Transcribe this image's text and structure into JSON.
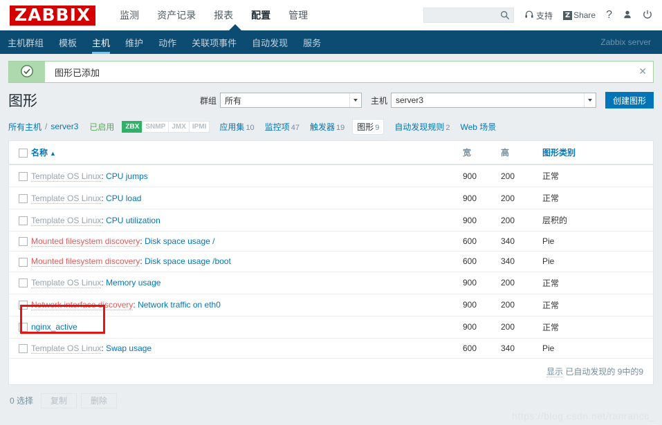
{
  "header": {
    "logo": "ZABBIX",
    "menu": [
      {
        "label": "监测",
        "selected": false
      },
      {
        "label": "资产记录",
        "selected": false
      },
      {
        "label": "报表",
        "selected": false
      },
      {
        "label": "配置",
        "selected": true
      },
      {
        "label": "管理",
        "selected": false
      }
    ],
    "search_placeholder": "",
    "search_value": "",
    "search_icon": "search-icon",
    "support_label": "支持",
    "support_icon": "headset-icon",
    "share_label": "Share",
    "share_icon": "zabbix-share-icon",
    "help_icon": "question-mark-icon",
    "user_icon": "user-icon",
    "signout_icon": "power-icon"
  },
  "subnav": {
    "items": [
      {
        "label": "主机群组",
        "selected": false
      },
      {
        "label": "模板",
        "selected": false
      },
      {
        "label": "主机",
        "selected": true
      },
      {
        "label": "维护",
        "selected": false
      },
      {
        "label": "动作",
        "selected": false
      },
      {
        "label": "关联项事件",
        "selected": false
      },
      {
        "label": "自动发现",
        "selected": false
      },
      {
        "label": "服务",
        "selected": false
      }
    ],
    "server": "Zabbix server"
  },
  "message": {
    "text": "图形已添加",
    "icon": "check-circle-icon",
    "close_icon": "close-icon",
    "accent": "#aed8ae"
  },
  "page": {
    "title": "图形",
    "group_label": "群组",
    "group_value": "所有",
    "host_label": "主机",
    "host_value": "server3",
    "create_button": "创建图形",
    "create_button_color": "#0275b8"
  },
  "breadcrumb": {
    "all_hosts": "所有主机",
    "separator": "/",
    "host": "server3",
    "status": "已启用",
    "status_color": "#5aab5a",
    "badges": [
      {
        "label": "ZBX",
        "active": true
      },
      {
        "label": "SNMP",
        "active": false
      },
      {
        "label": "JMX",
        "active": false
      },
      {
        "label": "IPMI",
        "active": false
      }
    ],
    "tabs": [
      {
        "label": "应用集",
        "count": "10",
        "selected": false
      },
      {
        "label": "监控项",
        "count": "47",
        "selected": false
      },
      {
        "label": "触发器",
        "count": "19",
        "selected": false
      },
      {
        "label": "图形",
        "count": "9",
        "selected": true
      },
      {
        "label": "自动发现规则",
        "count": "2",
        "selected": false
      },
      {
        "label": "Web 场景",
        "count": "",
        "selected": false
      }
    ]
  },
  "table": {
    "columns": {
      "name": "名称",
      "sort_indicator": "▲",
      "width": "宽",
      "height": "高",
      "type": "图形类别"
    },
    "rows": [
      {
        "prefix": "Template OS Linux",
        "prefix_kind": "template",
        "name": "CPU jumps",
        "width": "900",
        "height": "200",
        "type": "正常"
      },
      {
        "prefix": "Template OS Linux",
        "prefix_kind": "template",
        "name": "CPU load",
        "width": "900",
        "height": "200",
        "type": "正常"
      },
      {
        "prefix": "Template OS Linux",
        "prefix_kind": "template",
        "name": "CPU utilization",
        "width": "900",
        "height": "200",
        "type": "层积的"
      },
      {
        "prefix": "Mounted filesystem discovery",
        "prefix_kind": "discovery",
        "name": "Disk space usage /",
        "width": "600",
        "height": "340",
        "type": "Pie"
      },
      {
        "prefix": "Mounted filesystem discovery",
        "prefix_kind": "discovery",
        "name": "Disk space usage /boot",
        "width": "600",
        "height": "340",
        "type": "Pie"
      },
      {
        "prefix": "Template OS Linux",
        "prefix_kind": "template",
        "name": "Memory usage",
        "width": "900",
        "height": "200",
        "type": "正常"
      },
      {
        "prefix": "Network interface discovery",
        "prefix_kind": "discovery",
        "name": "Network traffic on eth0",
        "width": "900",
        "height": "200",
        "type": "正常"
      },
      {
        "prefix": "",
        "prefix_kind": "none",
        "name": "nginx_active",
        "width": "900",
        "height": "200",
        "type": "正常",
        "highlighted": true
      },
      {
        "prefix": "Template OS Linux",
        "prefix_kind": "template",
        "name": "Swap usage",
        "width": "600",
        "height": "340",
        "type": "Pie"
      }
    ],
    "footer": "显示 已自动发现的 9中的9",
    "footer_show_label": "显示",
    "footer_rest": "已自动发现的 9中的9"
  },
  "actions": {
    "selected_count": "0 选择",
    "copy_label": "复制",
    "delete_label": "删除"
  },
  "annotation": {
    "color": "#e81414",
    "target": "nginx_active"
  },
  "watermark": "https://blog.csdn.net/ranrancc_"
}
